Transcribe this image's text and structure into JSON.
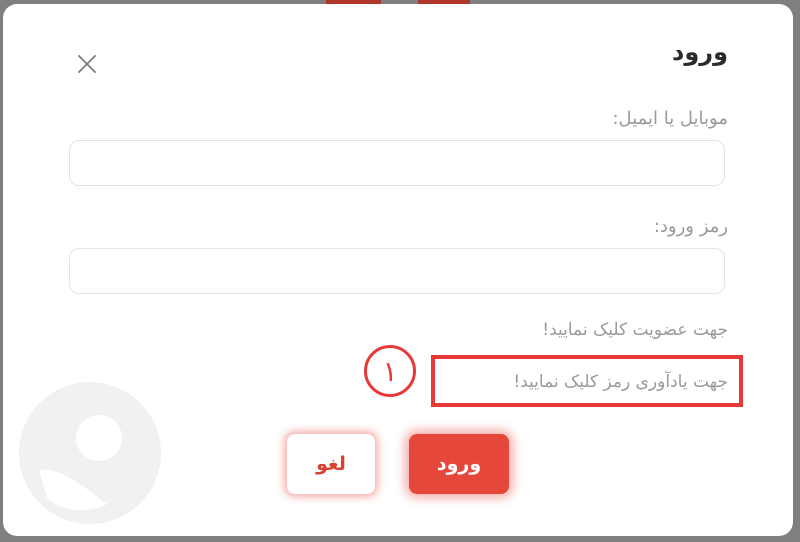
{
  "dialog": {
    "title": "ورود",
    "mobile_label": "موبایل یا ایمیل:",
    "mobile_value": "",
    "password_label": "رمز ورود:",
    "password_value": "",
    "register_link": "جهت عضویت کلیک نمایید!",
    "forgot_link": "جهت یادآوری رمز کلیک نمایید!",
    "cancel_label": "لغو",
    "login_label": "ورود"
  },
  "annotation": {
    "step_number": "۱"
  },
  "icons": {
    "close": "close-icon",
    "avatar_watermark": "user-avatar-icon"
  },
  "colors": {
    "accent": "#e5483a",
    "annotation": "#e83838",
    "label": "#9a9a9a",
    "title": "#2b2b2b"
  }
}
